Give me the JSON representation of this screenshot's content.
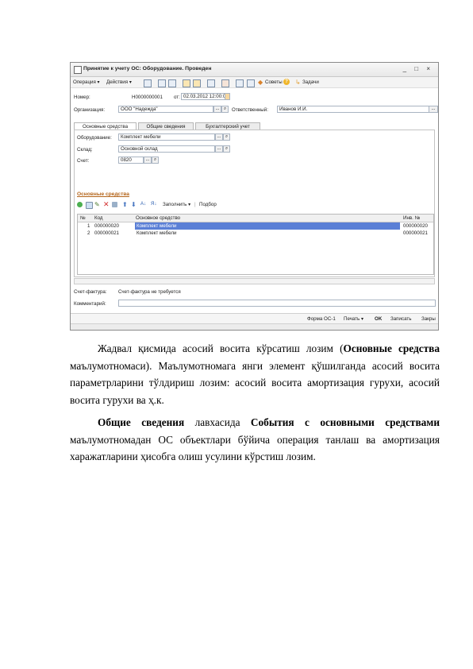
{
  "window": {
    "title": "Принятие к учету ОС: Оборудование. Проведен",
    "window_buttons": "_ □ ×",
    "menu": {
      "operation": "Операция ▾",
      "actions": "Действия ▾",
      "advice": "Советы",
      "help": "?",
      "tasks": "Задачи"
    },
    "header": {
      "number_label": "Номер:",
      "number_value": "Н0000000001",
      "from_label": "от:",
      "date_value": "02.03.2012 12:00:00",
      "org_label": "Организация:",
      "org_value": "ООО \"Надежда\"",
      "responsible_label": "Ответственный:",
      "responsible_value": "Иванов И.И."
    },
    "tabs": [
      "Основные средства",
      "Общие сведения",
      "Бухгалтерский учет"
    ],
    "form": {
      "equipment_label": "Оборудование:",
      "equipment_value": "Комплект мебели",
      "warehouse_label": "Склад:",
      "warehouse_value": "Основной склад",
      "account_label": "Счет:",
      "account_value": "0820"
    },
    "section_title": "Основные средства",
    "grid_toolbar": {
      "fill": "Заполнить ▾",
      "select": "Подбор"
    },
    "grid": {
      "columns": [
        "№",
        "Код",
        "Основное средство",
        "Инв. №"
      ],
      "rows": [
        {
          "n": "1",
          "code": "000000020",
          "asset": "Комплект мебели",
          "inv": "000000020"
        },
        {
          "n": "2",
          "code": "000000021",
          "asset": "Комплект мебели",
          "inv": "000000021"
        }
      ]
    },
    "footer": {
      "invoice_label": "Счет-фактура:",
      "invoice_value": "Счет-фактура не требуется",
      "comment_label": "Комментарий:"
    },
    "bottom": {
      "form_os1": "Форма ОС-1",
      "print": "Печать ▾",
      "ok": "OK",
      "save": "Записать",
      "close": "Закры"
    }
  },
  "text": {
    "p1_a": "Жадвал қисмида асосий восита кўрсатиш лозим (",
    "p1_bold": "Основные средства",
    "p1_b": " маълумотномаси). Маълумотномага янги элемент қўшилганда асосий восита параметрларини тўлдириш лозим: асосий восита амортизация гурухи, асосий восита гурухи ва ҳ.к.",
    "p2_bold1": "Общие сведения",
    "p2_a": " лавхасида ",
    "p2_bold2": "События с основными средствами",
    "p2_b": " маълумотномадан ОС объектлари бўйича операция танлаш ва амортизация харажатларини ҳисобга олиш усулини кўрстиш лозим."
  }
}
